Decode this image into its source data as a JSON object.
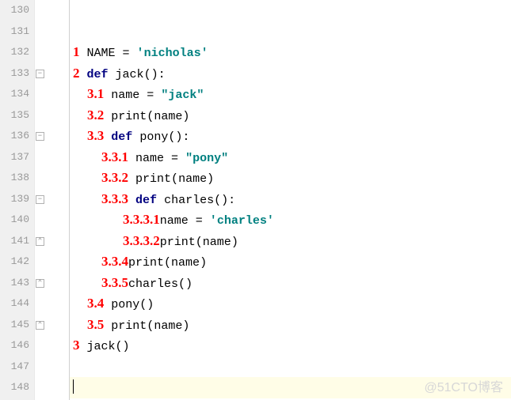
{
  "editor": {
    "line_numbers": [
      "130",
      "131",
      "132",
      "133",
      "134",
      "135",
      "136",
      "137",
      "138",
      "139",
      "140",
      "141",
      "142",
      "143",
      "144",
      "145",
      "146",
      "147",
      "148"
    ],
    "fold_markers": [
      {
        "line_index": 3,
        "glyph": "−"
      },
      {
        "line_index": 6,
        "glyph": "−"
      },
      {
        "line_index": 9,
        "glyph": "−"
      },
      {
        "line_index": 11,
        "glyph": "⌃"
      },
      {
        "line_index": 13,
        "glyph": "⌃"
      },
      {
        "line_index": 15,
        "glyph": "⌃"
      }
    ],
    "current_line_index": 18
  },
  "annotations": {
    "l132": "1",
    "l133": "2",
    "l134": "3.1",
    "l135": "3.2",
    "l136": "3.3",
    "l137": "3.3.1",
    "l138": "3.3.2",
    "l139": "3.3.3",
    "l140": "3.3.3.1",
    "l141": "3.3.3.2",
    "l142": "3.3.4",
    "l143": "3.3.5",
    "l144": "3.4",
    "l145": "3.5",
    "l146": "3"
  },
  "code": {
    "l132": {
      "id1": "NAME",
      "eq": " = ",
      "q1": "'",
      "str": "nicholas",
      "q2": "'"
    },
    "l133": {
      "kw": "def",
      "sp": " ",
      "fn": "jack",
      "paren": "():"
    },
    "l134": {
      "id1": "name",
      "eq": " = ",
      "q1": "\"",
      "str": "jack",
      "q2": "\""
    },
    "l135": {
      "fn": "print",
      "paren1": "(",
      "id": "name",
      "paren2": ")"
    },
    "l136": {
      "kw": "def",
      "sp": " ",
      "fn": "pony",
      "paren": "():"
    },
    "l137": {
      "id1": "name",
      "eq": " = ",
      "q1": "\"",
      "str": "pony",
      "q2": "\""
    },
    "l138": {
      "fn": "print",
      "paren1": "(",
      "id": "name",
      "paren2": ")"
    },
    "l139": {
      "kw": "def",
      "sp": " ",
      "fn": "charles",
      "paren": "():"
    },
    "l140": {
      "id1": "name",
      "eq": " = ",
      "q1": "'",
      "str": "charles",
      "q2": "'"
    },
    "l141": {
      "fn": "print",
      "paren1": "(",
      "id": "name",
      "paren2": ")"
    },
    "l142": {
      "fn": "print",
      "paren1": "(",
      "id": "name",
      "paren2": ")"
    },
    "l143": {
      "fn": "charles",
      "paren": "()"
    },
    "l144": {
      "fn": "pony",
      "paren": "()"
    },
    "l145": {
      "fn": "print",
      "paren1": "(",
      "id": "name",
      "paren2": ")"
    },
    "l146": {
      "fn": "jack",
      "paren": "()"
    }
  },
  "indent": {
    "base0": "",
    "base1": "    ",
    "base2": "        ",
    "base3": "            "
  },
  "watermark": "@51CTO博客"
}
